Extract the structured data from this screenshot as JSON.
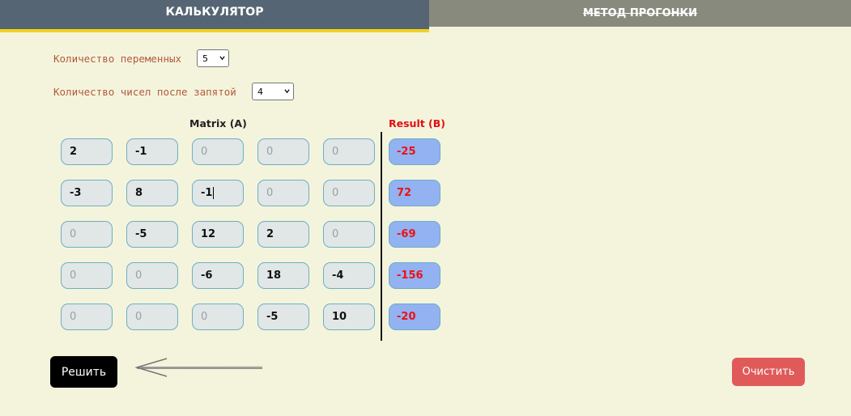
{
  "tabs": {
    "calculator": "КАЛЬКУЛЯТОР",
    "sweep_method": "МЕТОД ПРОГОНКИ"
  },
  "settings": {
    "variables_label": "Количество переменных",
    "variables_value": "5",
    "decimals_label": "Количество чисел после запятой",
    "decimals_value": "4"
  },
  "matrix": {
    "heading": "Matrix (A)",
    "rows": [
      [
        "2",
        "-1",
        "0",
        "0",
        "0"
      ],
      [
        "-3",
        "8",
        "-1",
        "0",
        "0"
      ],
      [
        "0",
        "-5",
        "12",
        "2",
        "0"
      ],
      [
        "0",
        "0",
        "-6",
        "18",
        "-4"
      ],
      [
        "0",
        "0",
        "0",
        "-5",
        "10"
      ]
    ]
  },
  "result": {
    "heading": "Result (B)",
    "values": [
      "-25",
      "72",
      "-69",
      "-156",
      "-20"
    ]
  },
  "buttons": {
    "solve": "Решить",
    "clear": "Очистить"
  },
  "colors": {
    "background": "#f4f4dd",
    "active_tab": "#566573",
    "active_tab_underline": "#f2d21c",
    "inactive_tab": "#888a7d",
    "result_cell": "#92b2f2",
    "result_text": "#ee1111",
    "solve_button": "#000000",
    "clear_button": "#e05a5a"
  }
}
